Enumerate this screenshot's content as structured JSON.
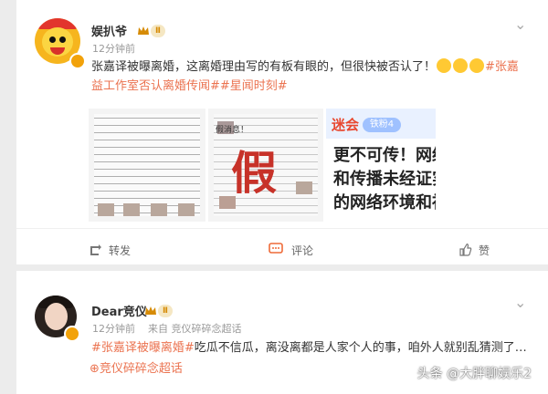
{
  "posts": [
    {
      "author": "娱扒爷",
      "level": "Ⅱ",
      "time": "12分钟前",
      "text": "张嘉译被曝离婚，这离婚理由写的有板有眼的，但很快被否认了！",
      "tags": "#张嘉益工作室否认离婚传闻##星闻时刻#",
      "images": [
        {
          "type": "document"
        },
        {
          "type": "fake-collage",
          "label": "假",
          "header": "假消息！"
        },
        {
          "type": "warning",
          "header": "迷会",
          "badge": "铁粉4",
          "lines": [
            "更不可传！网络",
            "和传播未经证实",
            "的网络环境和社"
          ]
        }
      ],
      "actions": {
        "repost": "转发",
        "comment": "评论",
        "like": "赞"
      }
    },
    {
      "author": "Dear竞仪",
      "level": "Ⅱ",
      "time": "12分钟前",
      "source": "来自 竞仪碎碎念超话",
      "tag": "#张嘉译被曝离婚#",
      "text": "吃瓜不信瓜，离没离都是人家个人的事，咱外人就别乱猜测了…",
      "topic": "竞仪碎碎念超话"
    }
  ],
  "watermark": "头条 @大胖聊娱乐2",
  "colors": {
    "accent": "#eb7350",
    "badge": "#d68b06"
  }
}
